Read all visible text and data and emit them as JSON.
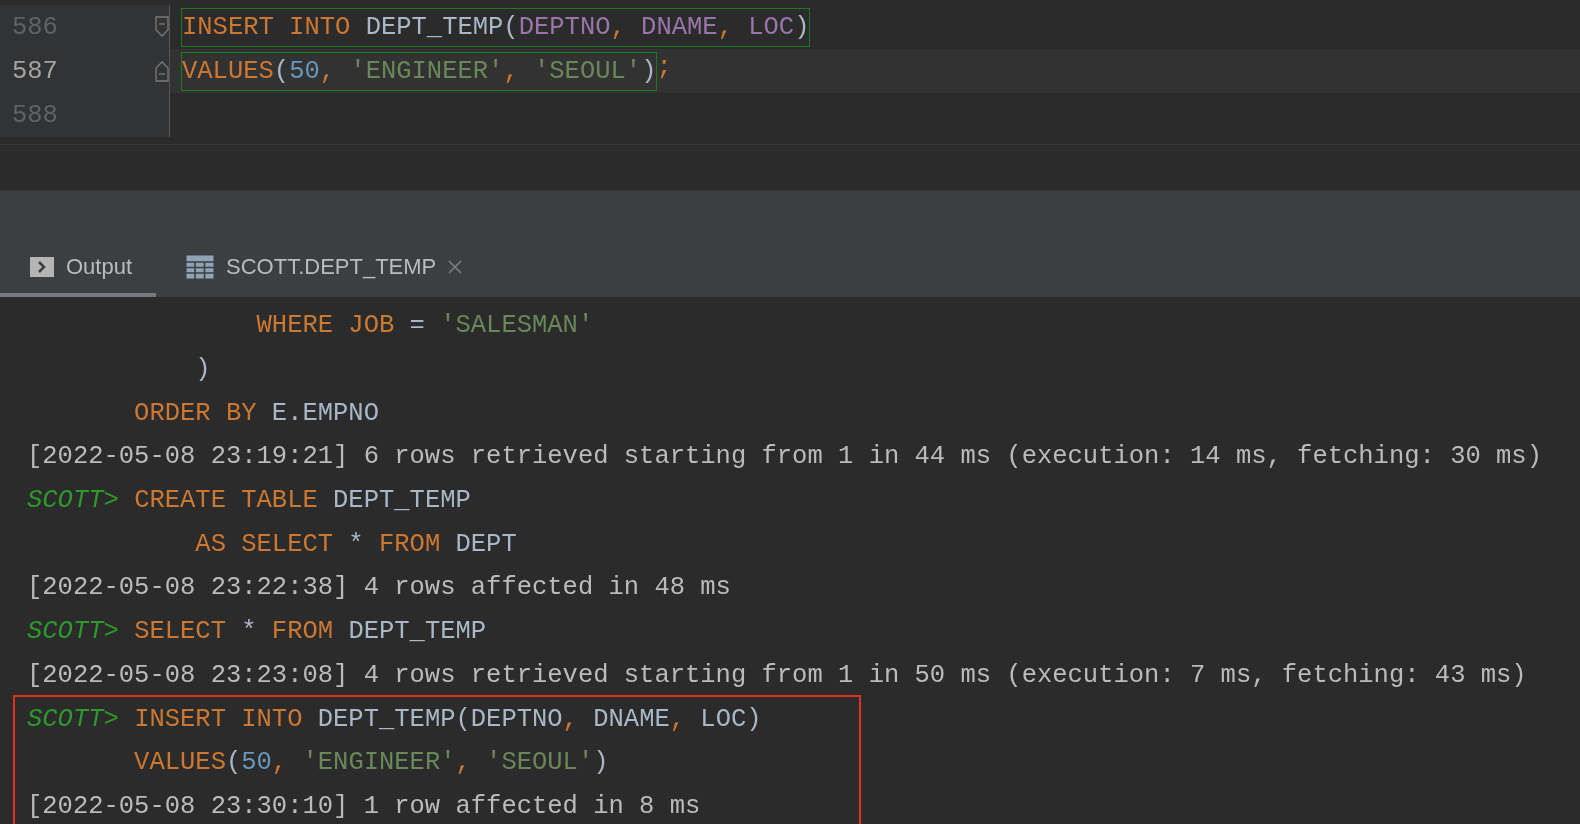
{
  "editor": {
    "lines": [
      {
        "number": "586",
        "current": false,
        "kind": "fold-start",
        "boxed": [
          {
            "t": "INSERT INTO ",
            "kind": "kw"
          },
          {
            "t": "DEPT_TEMP(",
            "kind": "id"
          },
          {
            "t": "DEPTNO",
            "kind": "col"
          },
          {
            "t": ", ",
            "kind": "punct"
          },
          {
            "t": "DNAME",
            "kind": "col"
          },
          {
            "t": ", ",
            "kind": "punct"
          },
          {
            "t": "LOC",
            "kind": "col"
          },
          {
            "t": ")",
            "kind": "id"
          }
        ]
      },
      {
        "number": "587",
        "current": true,
        "kind": "fold-end",
        "boxed": [
          {
            "t": "VALUES",
            "kind": "kw"
          },
          {
            "t": "(",
            "kind": "id"
          },
          {
            "t": "50",
            "kind": "num"
          },
          {
            "t": ", ",
            "kind": "punct"
          },
          {
            "t": "'ENGINEER'",
            "kind": "str"
          },
          {
            "t": ", ",
            "kind": "punct"
          },
          {
            "t": "'SEOUL'",
            "kind": "str"
          },
          {
            "t": ")",
            "kind": "id"
          }
        ],
        "after": [
          {
            "t": ";",
            "kind": "punct"
          }
        ]
      },
      {
        "number": "588",
        "current": false,
        "kind": "plain"
      }
    ]
  },
  "tabs": [
    {
      "label": "Output",
      "kind": "console",
      "selected": true,
      "closable": false
    },
    {
      "label": "SCOTT.DEPT_TEMP",
      "kind": "table",
      "selected": false,
      "closable": true
    }
  ],
  "console": {
    "entries": [
      {
        "highlighted": false,
        "lines": [
          [
            {
              "t": "               WHERE JOB ",
              "kind": "kw"
            },
            {
              "t": "= ",
              "kind": "id"
            },
            {
              "t": "'SALESMAN'",
              "kind": "str"
            }
          ],
          [
            {
              "t": "           )",
              "kind": "id"
            }
          ],
          [
            {
              "t": "       ORDER BY ",
              "kind": "kw"
            },
            {
              "t": "E.EMPNO",
              "kind": "id"
            }
          ],
          [
            {
              "t": "[2022-05-08 23:19:21] 6 rows retrieved starting from 1 in 44 ms (execution: 14 ms, fetching: 30 ms)",
              "kind": "log"
            }
          ],
          [
            {
              "t": "SCOTT> ",
              "kind": "prompt"
            },
            {
              "t": "CREATE TABLE ",
              "kind": "kw"
            },
            {
              "t": "DEPT_TEMP",
              "kind": "id"
            }
          ],
          [
            {
              "t": "           AS SELECT ",
              "kind": "kw"
            },
            {
              "t": "* ",
              "kind": "id"
            },
            {
              "t": "FROM ",
              "kind": "kw"
            },
            {
              "t": "DEPT",
              "kind": "id"
            }
          ],
          [
            {
              "t": "[2022-05-08 23:22:38] 4 rows affected in 48 ms",
              "kind": "log"
            }
          ],
          [
            {
              "t": "SCOTT> ",
              "kind": "prompt"
            },
            {
              "t": "SELECT ",
              "kind": "kw"
            },
            {
              "t": "* ",
              "kind": "id"
            },
            {
              "t": "FROM ",
              "kind": "kw"
            },
            {
              "t": "DEPT_TEMP",
              "kind": "id"
            }
          ],
          [
            {
              "t": "[2022-05-08 23:23:08] 4 rows retrieved starting from 1 in 50 ms (execution: 7 ms, fetching: 43 ms)",
              "kind": "log"
            }
          ]
        ]
      },
      {
        "highlighted": true,
        "lines": [
          [
            {
              "t": "SCOTT> ",
              "kind": "prompt"
            },
            {
              "t": "INSERT INTO ",
              "kind": "kw"
            },
            {
              "t": "DEPT_TEMP(DEPTNO",
              "kind": "id"
            },
            {
              "t": ", ",
              "kind": "punct"
            },
            {
              "t": "DNAME",
              "kind": "id"
            },
            {
              "t": ", ",
              "kind": "punct"
            },
            {
              "t": "LOC)",
              "kind": "id"
            }
          ],
          [
            {
              "t": "       VALUES",
              "kind": "kw"
            },
            {
              "t": "(",
              "kind": "id"
            },
            {
              "t": "50",
              "kind": "num"
            },
            {
              "t": ", ",
              "kind": "punct"
            },
            {
              "t": "'ENGINEER'",
              "kind": "str"
            },
            {
              "t": ", ",
              "kind": "punct"
            },
            {
              "t": "'SEOUL'",
              "kind": "str"
            },
            {
              "t": ")",
              "kind": "id"
            }
          ],
          [
            {
              "t": "[2022-05-08 23:30:10] 1 row affected in 8 ms",
              "kind": "log"
            }
          ]
        ]
      }
    ]
  }
}
